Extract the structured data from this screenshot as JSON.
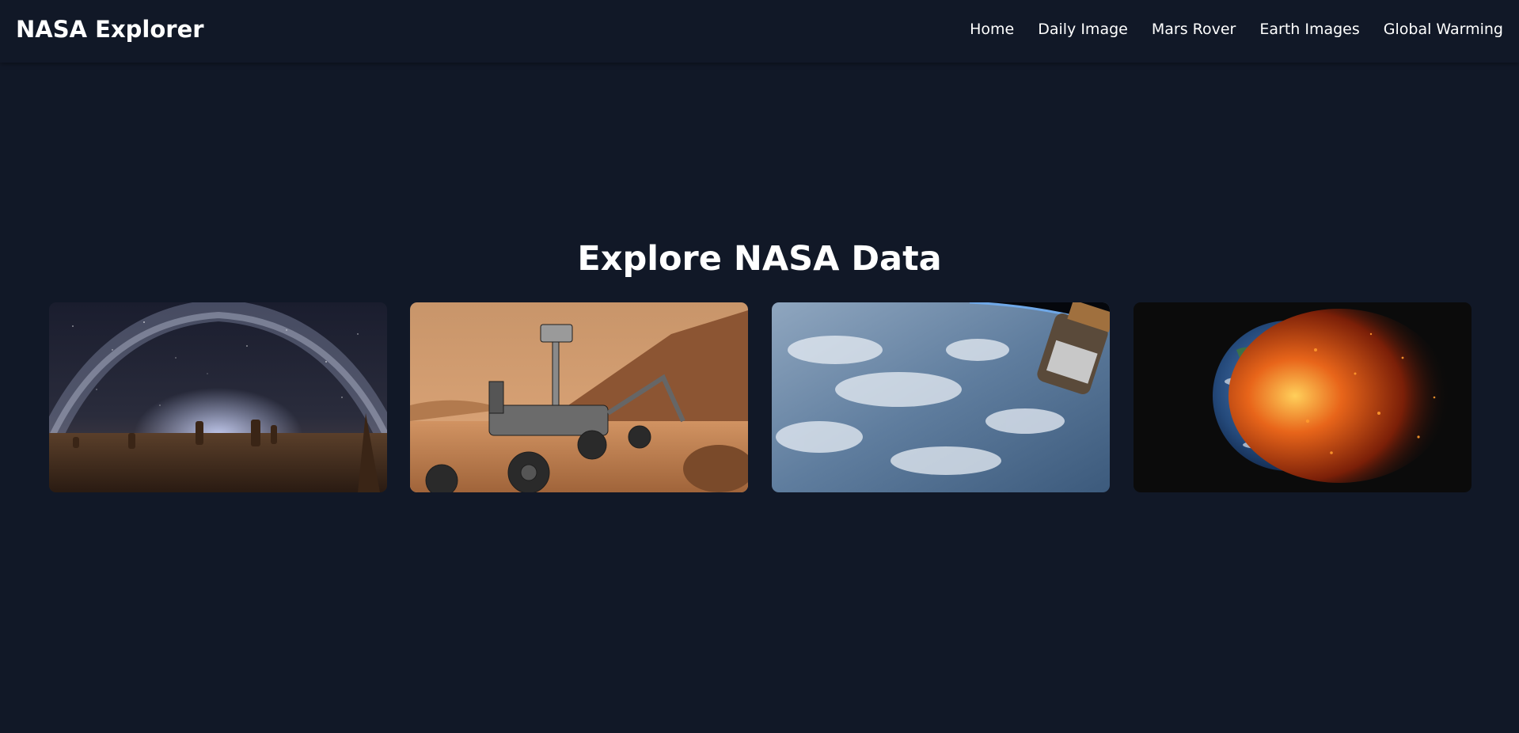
{
  "header": {
    "brand": "NASA Explorer",
    "nav": [
      {
        "label": "Home"
      },
      {
        "label": "Daily Image"
      },
      {
        "label": "Mars Rover"
      },
      {
        "label": "Earth Images"
      },
      {
        "label": "Global Warming"
      }
    ]
  },
  "main": {
    "title": "Explore NASA Data",
    "cards": [
      {
        "subject": "milky-way-night-sky"
      },
      {
        "subject": "mars-rover"
      },
      {
        "subject": "earth-from-space-station"
      },
      {
        "subject": "burning-earth"
      }
    ]
  },
  "colors": {
    "background": "#111827",
    "text": "#ffffff"
  }
}
